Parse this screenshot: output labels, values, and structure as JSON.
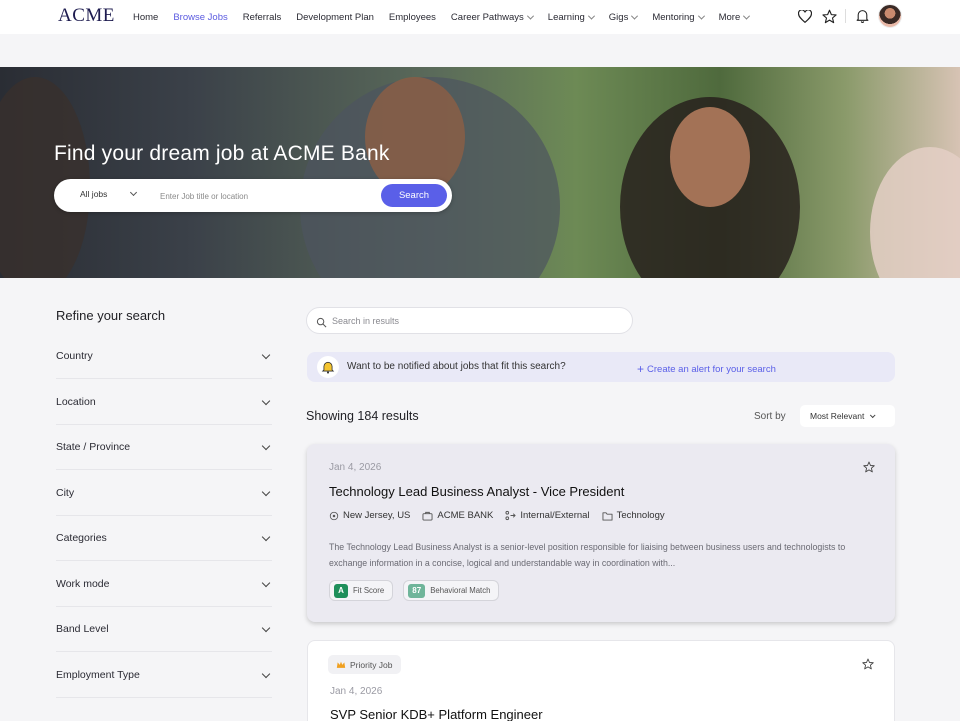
{
  "nav": {
    "logo": "ACME",
    "items": [
      {
        "label": "Home",
        "active": false,
        "dropdown": false
      },
      {
        "label": "Browse Jobs",
        "active": true,
        "dropdown": false
      },
      {
        "label": "Referrals",
        "active": false,
        "dropdown": false
      },
      {
        "label": "Development Plan",
        "active": false,
        "dropdown": false
      },
      {
        "label": "Employees",
        "active": false,
        "dropdown": false
      },
      {
        "label": "Career Pathways",
        "active": false,
        "dropdown": true
      },
      {
        "label": "Learning",
        "active": false,
        "dropdown": true
      },
      {
        "label": "Gigs",
        "active": false,
        "dropdown": true
      },
      {
        "label": "Mentoring",
        "active": false,
        "dropdown": true
      },
      {
        "label": "More",
        "active": false,
        "dropdown": true
      }
    ],
    "icons": [
      "heart-icon",
      "star-icon",
      "bell-icon",
      "avatar"
    ]
  },
  "hero": {
    "title": "Find your dream job at ACME Bank",
    "search": {
      "scope": "All jobs",
      "placeholder": "Enter Job title or location",
      "button": "Search"
    }
  },
  "sidebar": {
    "title": "Refine your search",
    "filters": [
      "Country",
      "Location",
      "State / Province",
      "City",
      "Categories",
      "Work mode",
      "Band Level",
      "Employment Type"
    ]
  },
  "results": {
    "search_placeholder": "Search in results",
    "alert_text": "Want to be notified about jobs that fit this search?",
    "alert_link": "Create an alert for your search",
    "count": "Showing 184 results",
    "sort_label": "Sort by",
    "sort_value": "Most Relevant",
    "jobs": [
      {
        "date": "Jan 4, 2026",
        "title": "Technology Lead Business Analyst - Vice President",
        "location": "New Jersey, US",
        "company": "ACME BANK",
        "type": "Internal/External",
        "category": "Technology",
        "description": "The Technology Lead Business Analyst is a senior-level position responsible for liaising between business users and technologists to exchange information in a concise, logical and understandable way in coordination with...",
        "tags": [
          {
            "badge": "A",
            "label": "Fit Score",
            "color": "#1e8f5a"
          },
          {
            "badge": "87",
            "label": "Behavioral Match",
            "color": "#6fb59a"
          }
        ]
      },
      {
        "priority": "Priority Job",
        "date": "Jan 4, 2026",
        "title": "SVP Senior KDB+ Platform Engineer"
      }
    ]
  },
  "colors": {
    "accent": "#5a5fe8",
    "brand": "#1d1b4f",
    "alert_bg": "#e9e9f7"
  }
}
